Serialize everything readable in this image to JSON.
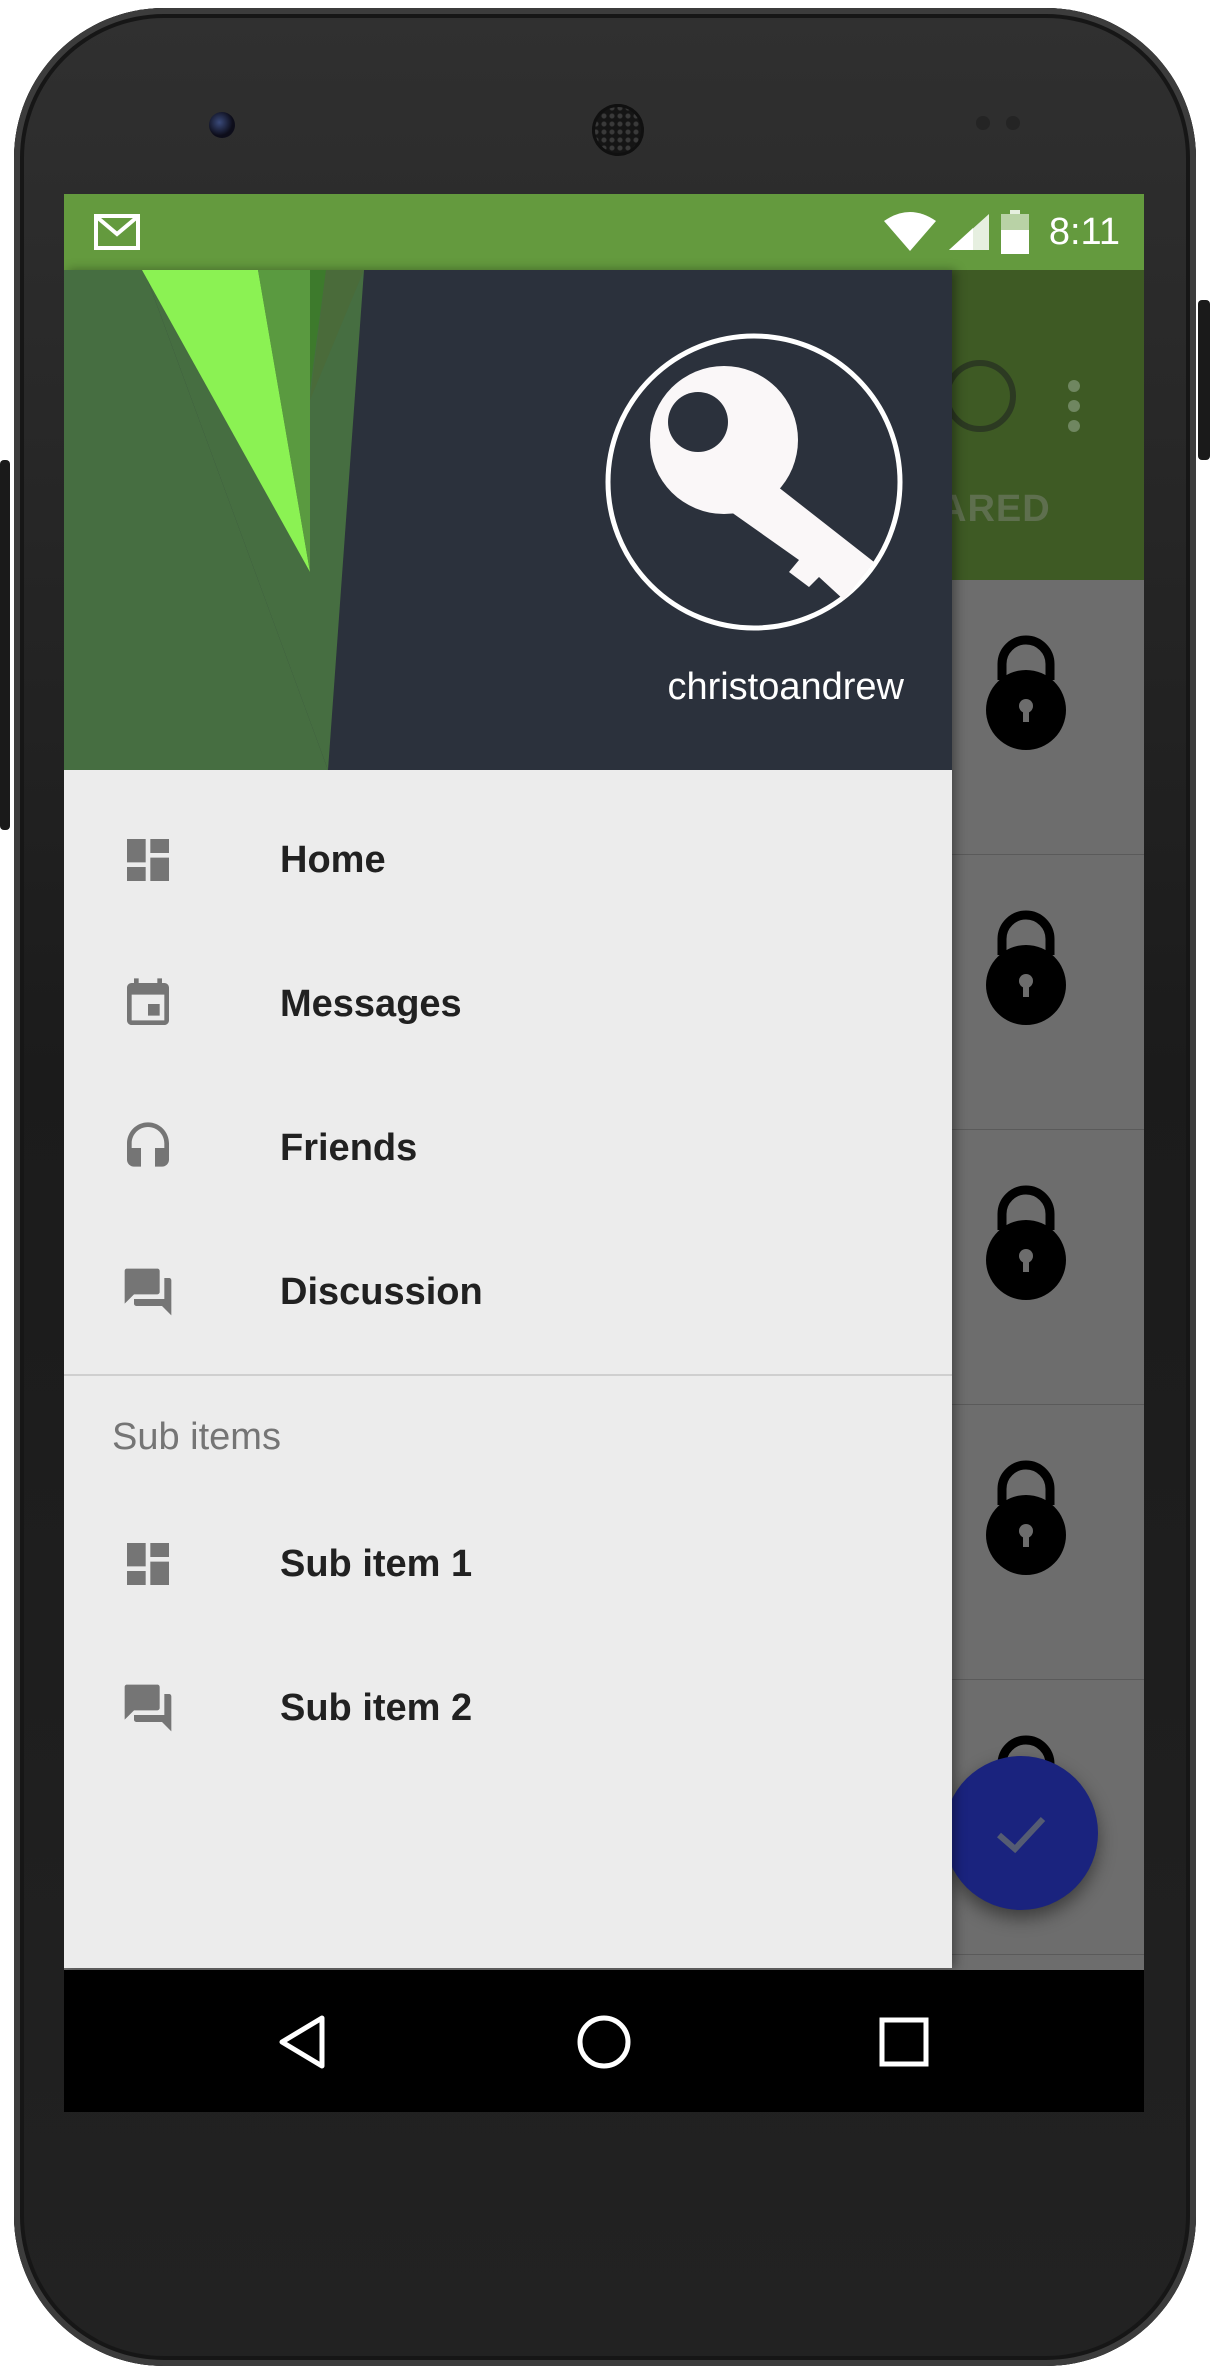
{
  "status_bar": {
    "notification_icon": "gmail-icon",
    "time": "8:11",
    "icons": [
      "wifi-icon",
      "signal-icon",
      "battery-icon"
    ],
    "background": "#649a3e"
  },
  "background_app": {
    "toolbar_color": "#3e5a24",
    "tab_label": "ARED",
    "list_icon": "lock-icon",
    "fab_icon": "check-icon",
    "fab_color": "#1a237e"
  },
  "drawer": {
    "header": {
      "username": "christoandrew",
      "avatar_icon": "key-icon",
      "background": "#2b313c",
      "accent_colors": [
        "#466e41",
        "#8bf253"
      ]
    },
    "items": [
      {
        "label": "Home",
        "icon": "dashboard-icon"
      },
      {
        "label": "Messages",
        "icon": "calendar-icon"
      },
      {
        "label": "Friends",
        "icon": "headset-icon"
      },
      {
        "label": "Discussion",
        "icon": "forum-icon"
      }
    ],
    "sub_header": "Sub items",
    "sub_items": [
      {
        "label": "Sub item 1",
        "icon": "dashboard-icon"
      },
      {
        "label": "Sub item 2",
        "icon": "forum-icon"
      }
    ]
  },
  "navigation_bar": {
    "buttons": [
      "back-icon",
      "home-icon",
      "recents-icon"
    ]
  }
}
